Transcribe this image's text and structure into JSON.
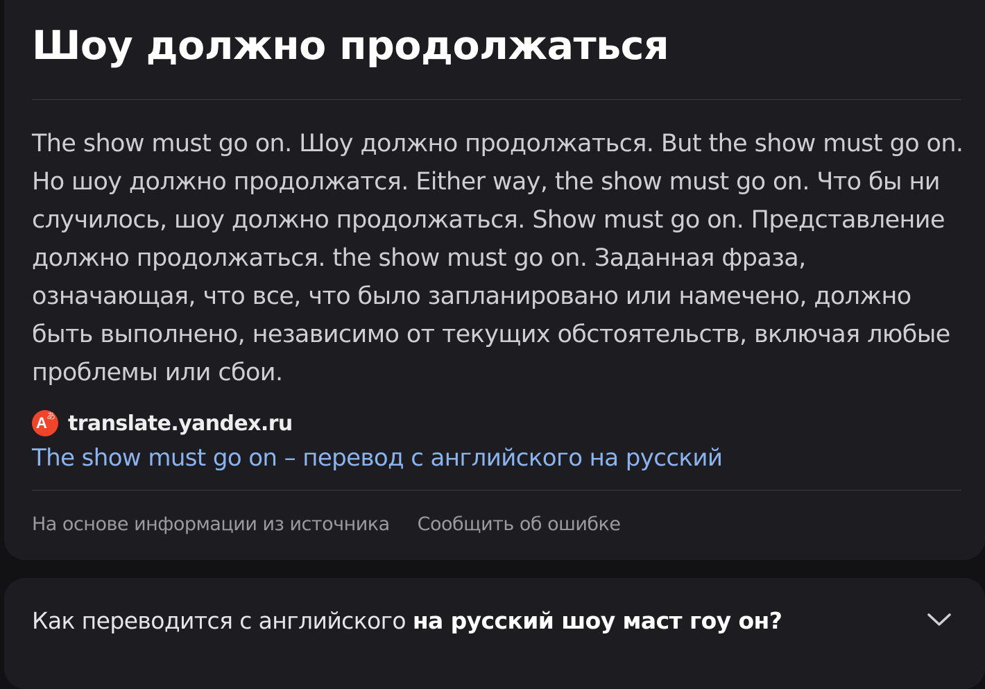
{
  "answer": {
    "title": "Шоу должно продолжаться",
    "body": "The show must go on. Шоу должно продолжаться. But the show must go on. Но шоу должно продолжатся. Either way, the show must go on. Что бы ни случилось, шоу должно продолжаться. Show must go on. Представление должно продолжаться. the show must go on. Заданная фраза, означающая, что все, что было запланировано или намечено, должно быть выполнено, независимо от текущих обстоятельств, включая любые проблемы или сбои.",
    "source": {
      "icon": "yandex-translate-icon",
      "icon_color": "#f2432b",
      "domain": "translate.yandex.ru",
      "link_text": "The show must go on – перевод с английского на русский",
      "link_color": "#8ab4f0"
    },
    "footer": {
      "based_on": "На основе информации из источника",
      "report": "Сообщить об ошибке"
    }
  },
  "related_question": {
    "prefix": "Как переводится с английского ",
    "bold": "на русский шоу маст гоу он?",
    "expand_icon": "chevron-down-icon"
  }
}
